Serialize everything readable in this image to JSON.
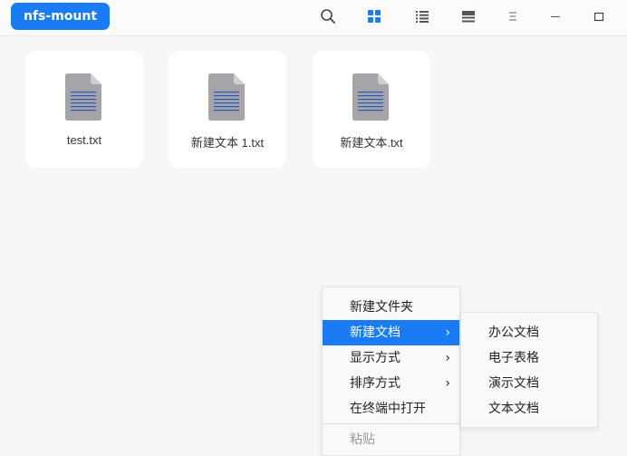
{
  "titlebar": {
    "breadcrumb": "nfs-mount",
    "accent": "#1a7cf5",
    "buttons": [
      {
        "name": "search-icon"
      },
      {
        "name": "icon-view-icon",
        "active": true
      },
      {
        "name": "list-view-icon"
      },
      {
        "name": "detail-view-icon"
      },
      {
        "name": "menu-icon"
      },
      {
        "name": "minimize-icon"
      },
      {
        "name": "maximize-icon"
      }
    ]
  },
  "files": [
    {
      "name": "test.txt",
      "icon": "text-file-icon"
    },
    {
      "name": "新建文本 1.txt",
      "icon": "text-file-icon"
    },
    {
      "name": "新建文本.txt",
      "icon": "text-file-icon"
    }
  ],
  "context_menu": {
    "items": [
      {
        "label": "新建文件夹"
      },
      {
        "label": "新建文档",
        "arrow": "›"
      },
      {
        "label": "显示方式",
        "arrow": "›"
      },
      {
        "label": "排序方式",
        "arrow": "›"
      },
      {
        "label": "在终端中打开"
      },
      {
        "label": "粘贴"
      }
    ]
  },
  "submenu": {
    "items": [
      {
        "label": "办公文档"
      },
      {
        "label": "电子表格"
      },
      {
        "label": "演示文档"
      },
      {
        "label": "文本文档"
      }
    ]
  }
}
